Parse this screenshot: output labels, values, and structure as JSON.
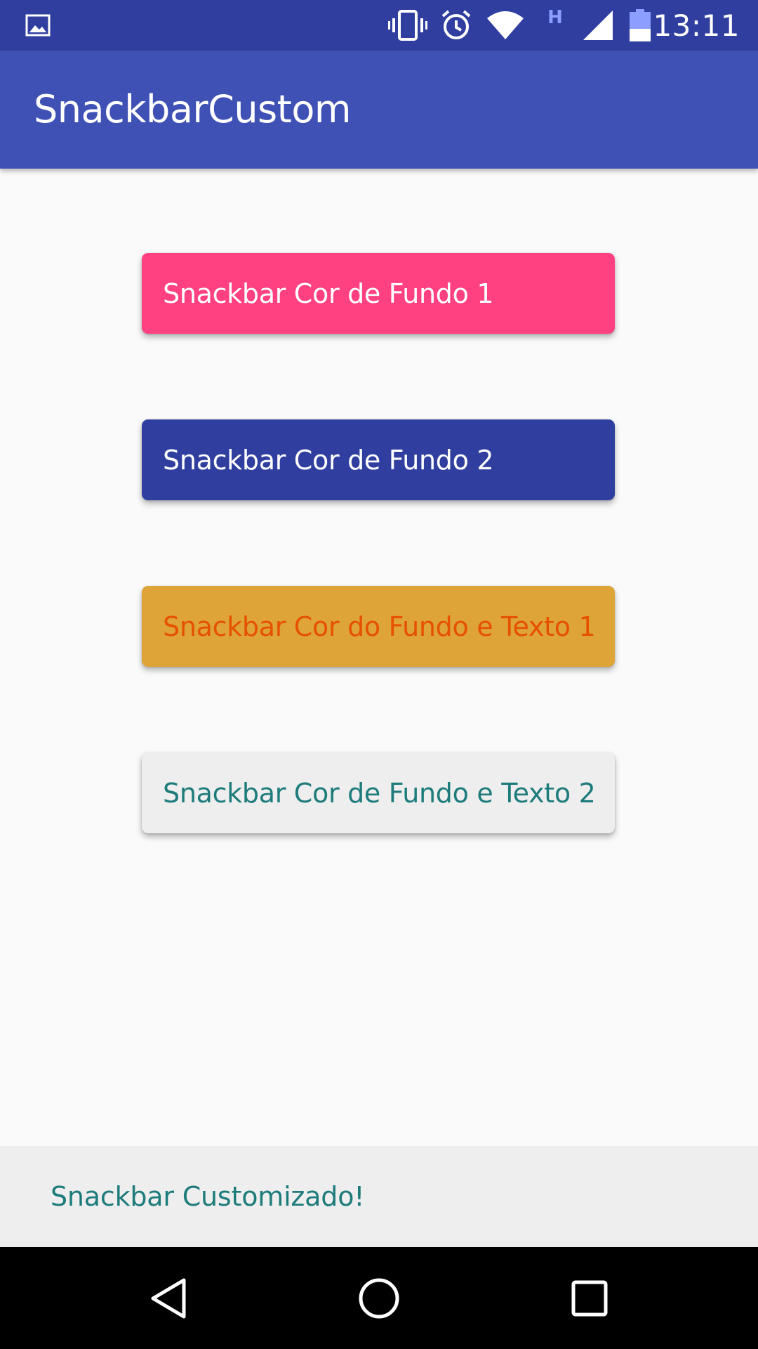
{
  "status_bar": {
    "time": "13:11",
    "icons": [
      "image-notification-icon",
      "vibrate-icon",
      "alarm-icon",
      "wifi-icon",
      "network-h-icon",
      "signal-icon",
      "battery-icon"
    ],
    "network_type": "H"
  },
  "app_bar": {
    "title": "SnackbarCustom"
  },
  "buttons": [
    {
      "label": "Snackbar Cor de Fundo 1",
      "background": "#FF4081",
      "text_color": "#FFFFFF"
    },
    {
      "label": "Snackbar Cor de Fundo 2",
      "background": "#303F9F",
      "text_color": "#FFFFFF"
    },
    {
      "label": "Snackbar Cor do Fundo e Texto 1",
      "background": "#DFA437",
      "text_color": "#E65100"
    },
    {
      "label": "Snackbar Cor de Fundo e Texto 2",
      "background": "#EEEEEE",
      "text_color": "#1E7B7C"
    }
  ],
  "snackbar": {
    "message": "Snackbar Customizado!",
    "background": "#EEEEEE",
    "text_color": "#1E7B7C"
  },
  "nav_bar": {
    "icons": [
      "back-icon",
      "home-icon",
      "recents-icon"
    ]
  },
  "colors": {
    "status_bar": "#303F9F",
    "primary": "#3F51B5",
    "background": "#FAFAFA"
  }
}
